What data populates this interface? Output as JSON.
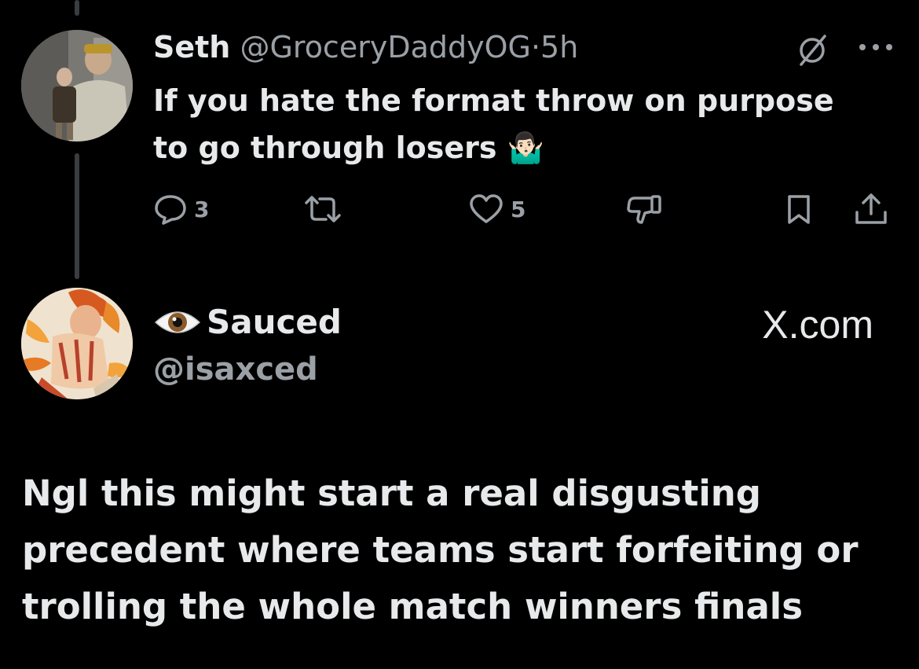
{
  "reply_tweet": {
    "author_name": "Seth",
    "handle": "@GroceryDaddyOG",
    "separator": "·",
    "time": "5h",
    "text_line1": "If you hate the format throw on purpose",
    "text_line2": "to go through losers",
    "text_emoji": "🤷🏻‍♂️",
    "actions": {
      "reply_count": "3",
      "like_count": "5"
    }
  },
  "quoted_post": {
    "name_emoji": "👁",
    "author_name": "Sauced",
    "handle": "@isaxced",
    "site_label": "X.com",
    "text": "Ngl this might start a real disgusting precedent where teams start forfeiting or trolling the whole match winners finals"
  },
  "colors": {
    "background": "#000000",
    "primary_text": "#e7e9ea",
    "secondary_text": "#9aa0a6"
  }
}
